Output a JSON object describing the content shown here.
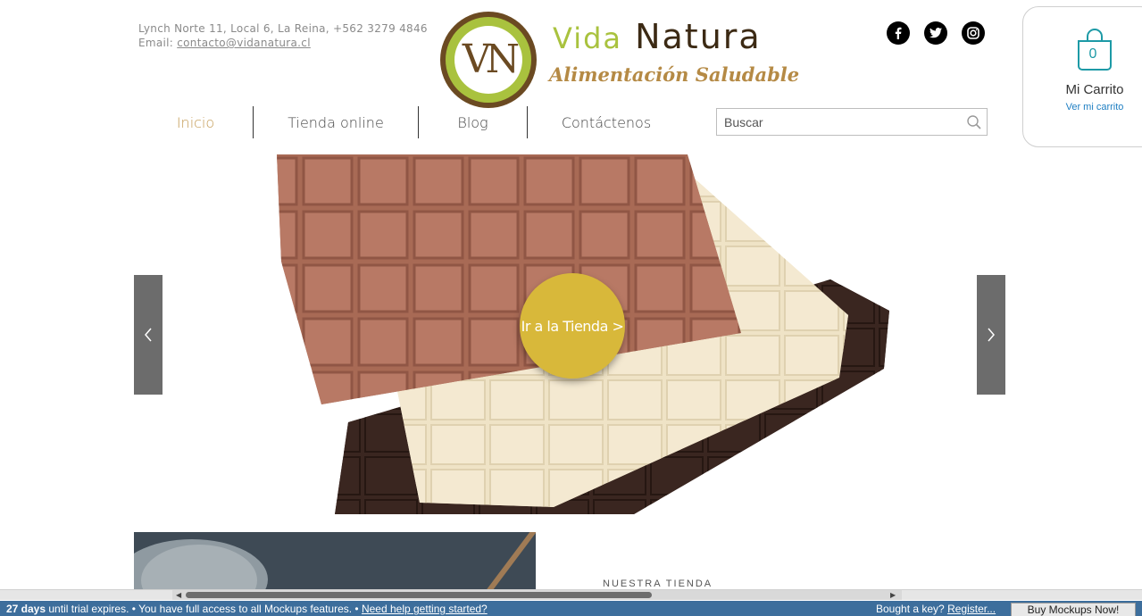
{
  "header": {
    "address": "Lynch Norte 11, Local 6, La Reina, +562 3279 4846",
    "email_label": "Email: ",
    "email": "contacto@vidanatura.cl"
  },
  "logo": {
    "monogram": "VN",
    "name_part1": "Vida",
    "name_part2": "Natura",
    "tagline": "Alimentación Saludable"
  },
  "social": [
    {
      "icon": "facebook-icon"
    },
    {
      "icon": "twitter-icon"
    },
    {
      "icon": "instagram-icon"
    }
  ],
  "cart": {
    "count": "0",
    "title": "Mi Carrito",
    "link": "Ver mi carrito"
  },
  "nav": {
    "items": [
      {
        "label": "Inicio",
        "active": true
      },
      {
        "label": "Tienda online"
      },
      {
        "label": "Blog"
      },
      {
        "label": "Contáctenos"
      }
    ]
  },
  "search": {
    "placeholder": "Buscar"
  },
  "hero": {
    "cta_label": "Ir a la Tienda >",
    "prev_icon": "chevron-left-icon",
    "next_icon": "chevron-right-icon"
  },
  "section": {
    "heading": "NUESTRA TIENDA"
  },
  "trial": {
    "days": "27 days",
    "message": " until trial expires. • You have full access to all Mockups features. • ",
    "help_link": "Need help getting started?",
    "bought": "Bought a key? ",
    "register": "Register...",
    "buy_button": "Buy Mockups Now!"
  },
  "colors": {
    "accent_gold": "#c39a53",
    "logo_green": "#a9c23e",
    "logo_brown": "#6b4a22",
    "cta": "#d8b83a",
    "trial_bar": "#3d6e9c",
    "cart_teal": "#1d9aa6"
  }
}
